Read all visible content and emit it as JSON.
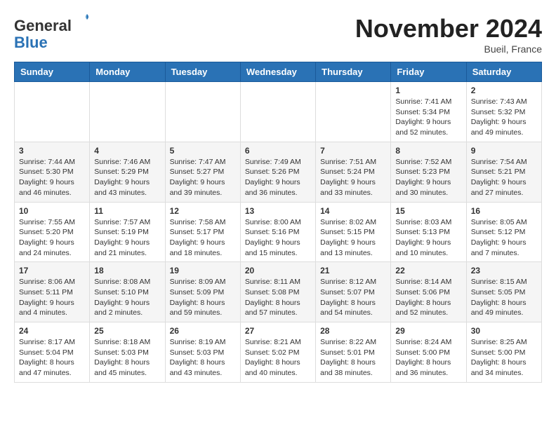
{
  "logo": {
    "general": "General",
    "blue": "Blue"
  },
  "header": {
    "month": "November 2024",
    "location": "Bueil, France"
  },
  "weekdays": [
    "Sunday",
    "Monday",
    "Tuesday",
    "Wednesday",
    "Thursday",
    "Friday",
    "Saturday"
  ],
  "weeks": [
    [
      {
        "day": "",
        "info": ""
      },
      {
        "day": "",
        "info": ""
      },
      {
        "day": "",
        "info": ""
      },
      {
        "day": "",
        "info": ""
      },
      {
        "day": "",
        "info": ""
      },
      {
        "day": "1",
        "info": "Sunrise: 7:41 AM\nSunset: 5:34 PM\nDaylight: 9 hours\nand 52 minutes."
      },
      {
        "day": "2",
        "info": "Sunrise: 7:43 AM\nSunset: 5:32 PM\nDaylight: 9 hours\nand 49 minutes."
      }
    ],
    [
      {
        "day": "3",
        "info": "Sunrise: 7:44 AM\nSunset: 5:30 PM\nDaylight: 9 hours\nand 46 minutes."
      },
      {
        "day": "4",
        "info": "Sunrise: 7:46 AM\nSunset: 5:29 PM\nDaylight: 9 hours\nand 43 minutes."
      },
      {
        "day": "5",
        "info": "Sunrise: 7:47 AM\nSunset: 5:27 PM\nDaylight: 9 hours\nand 39 minutes."
      },
      {
        "day": "6",
        "info": "Sunrise: 7:49 AM\nSunset: 5:26 PM\nDaylight: 9 hours\nand 36 minutes."
      },
      {
        "day": "7",
        "info": "Sunrise: 7:51 AM\nSunset: 5:24 PM\nDaylight: 9 hours\nand 33 minutes."
      },
      {
        "day": "8",
        "info": "Sunrise: 7:52 AM\nSunset: 5:23 PM\nDaylight: 9 hours\nand 30 minutes."
      },
      {
        "day": "9",
        "info": "Sunrise: 7:54 AM\nSunset: 5:21 PM\nDaylight: 9 hours\nand 27 minutes."
      }
    ],
    [
      {
        "day": "10",
        "info": "Sunrise: 7:55 AM\nSunset: 5:20 PM\nDaylight: 9 hours\nand 24 minutes."
      },
      {
        "day": "11",
        "info": "Sunrise: 7:57 AM\nSunset: 5:19 PM\nDaylight: 9 hours\nand 21 minutes."
      },
      {
        "day": "12",
        "info": "Sunrise: 7:58 AM\nSunset: 5:17 PM\nDaylight: 9 hours\nand 18 minutes."
      },
      {
        "day": "13",
        "info": "Sunrise: 8:00 AM\nSunset: 5:16 PM\nDaylight: 9 hours\nand 15 minutes."
      },
      {
        "day": "14",
        "info": "Sunrise: 8:02 AM\nSunset: 5:15 PM\nDaylight: 9 hours\nand 13 minutes."
      },
      {
        "day": "15",
        "info": "Sunrise: 8:03 AM\nSunset: 5:13 PM\nDaylight: 9 hours\nand 10 minutes."
      },
      {
        "day": "16",
        "info": "Sunrise: 8:05 AM\nSunset: 5:12 PM\nDaylight: 9 hours\nand 7 minutes."
      }
    ],
    [
      {
        "day": "17",
        "info": "Sunrise: 8:06 AM\nSunset: 5:11 PM\nDaylight: 9 hours\nand 4 minutes."
      },
      {
        "day": "18",
        "info": "Sunrise: 8:08 AM\nSunset: 5:10 PM\nDaylight: 9 hours\nand 2 minutes."
      },
      {
        "day": "19",
        "info": "Sunrise: 8:09 AM\nSunset: 5:09 PM\nDaylight: 8 hours\nand 59 minutes."
      },
      {
        "day": "20",
        "info": "Sunrise: 8:11 AM\nSunset: 5:08 PM\nDaylight: 8 hours\nand 57 minutes."
      },
      {
        "day": "21",
        "info": "Sunrise: 8:12 AM\nSunset: 5:07 PM\nDaylight: 8 hours\nand 54 minutes."
      },
      {
        "day": "22",
        "info": "Sunrise: 8:14 AM\nSunset: 5:06 PM\nDaylight: 8 hours\nand 52 minutes."
      },
      {
        "day": "23",
        "info": "Sunrise: 8:15 AM\nSunset: 5:05 PM\nDaylight: 8 hours\nand 49 minutes."
      }
    ],
    [
      {
        "day": "24",
        "info": "Sunrise: 8:17 AM\nSunset: 5:04 PM\nDaylight: 8 hours\nand 47 minutes."
      },
      {
        "day": "25",
        "info": "Sunrise: 8:18 AM\nSunset: 5:03 PM\nDaylight: 8 hours\nand 45 minutes."
      },
      {
        "day": "26",
        "info": "Sunrise: 8:19 AM\nSunset: 5:03 PM\nDaylight: 8 hours\nand 43 minutes."
      },
      {
        "day": "27",
        "info": "Sunrise: 8:21 AM\nSunset: 5:02 PM\nDaylight: 8 hours\nand 40 minutes."
      },
      {
        "day": "28",
        "info": "Sunrise: 8:22 AM\nSunset: 5:01 PM\nDaylight: 8 hours\nand 38 minutes."
      },
      {
        "day": "29",
        "info": "Sunrise: 8:24 AM\nSunset: 5:00 PM\nDaylight: 8 hours\nand 36 minutes."
      },
      {
        "day": "30",
        "info": "Sunrise: 8:25 AM\nSunset: 5:00 PM\nDaylight: 8 hours\nand 34 minutes."
      }
    ]
  ]
}
